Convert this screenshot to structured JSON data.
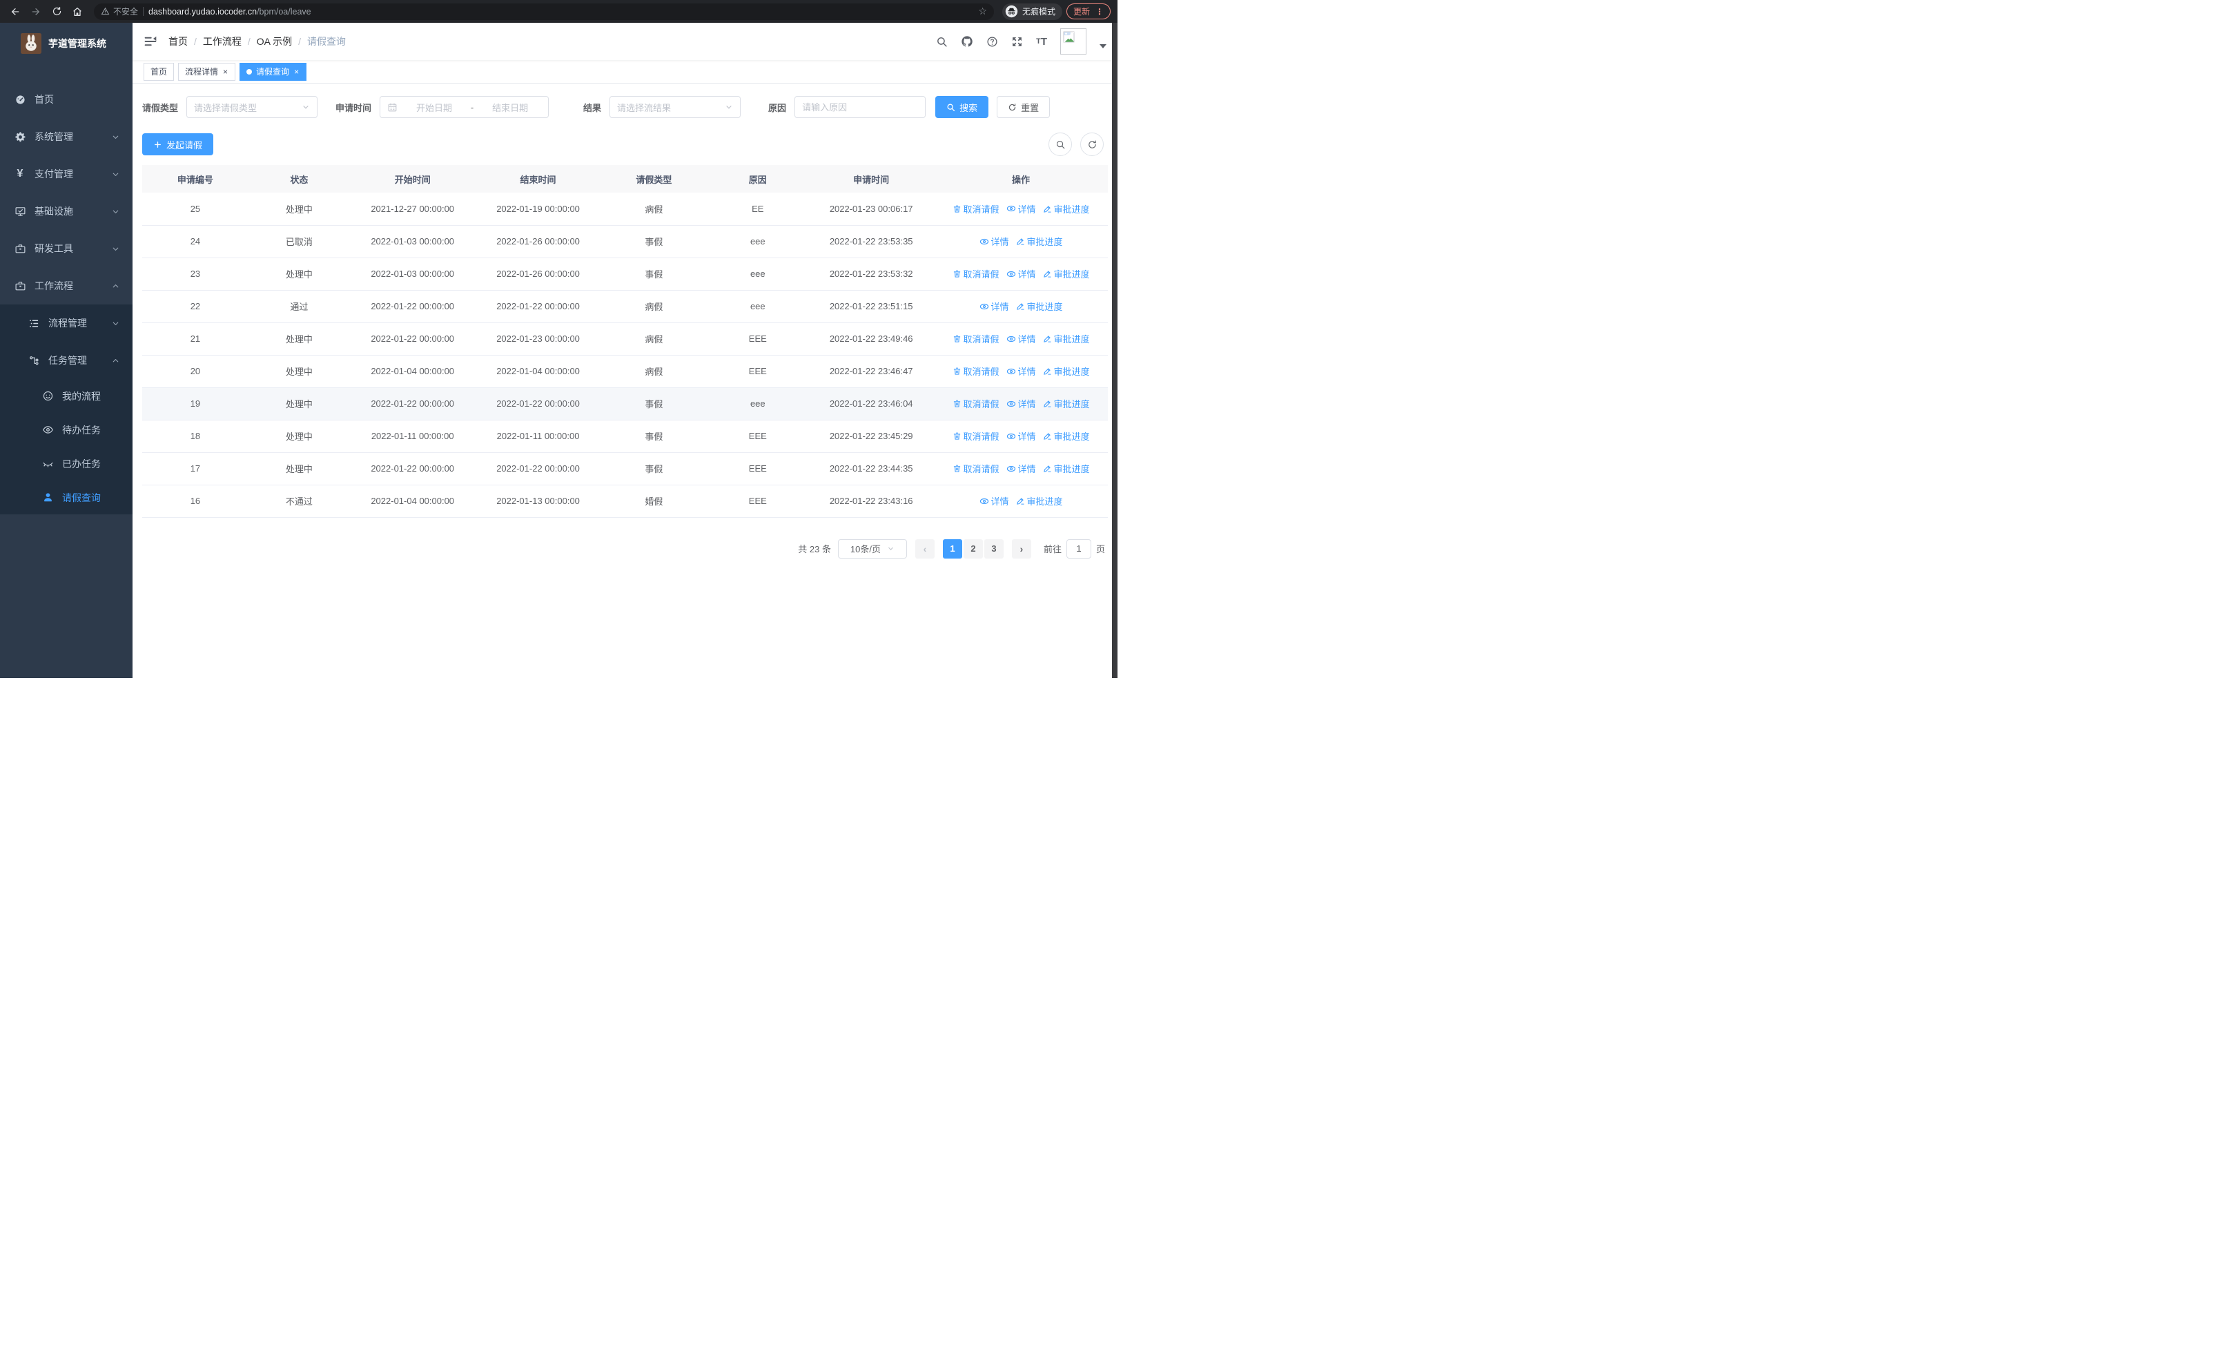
{
  "browser": {
    "security_label": "不安全",
    "url_host": "dashboard.yudao.iocoder.cn",
    "url_path": "/bpm/oa/leave",
    "incognito_label": "无痕模式",
    "update_label": "更新"
  },
  "sidebar": {
    "app_title": "芋道管理系统",
    "menu": [
      {
        "label": "首页",
        "icon": "dashboard-icon",
        "level": 1,
        "expand": null,
        "active": false
      },
      {
        "label": "系统管理",
        "icon": "gear-icon",
        "level": 1,
        "expand": "down",
        "active": false
      },
      {
        "label": "支付管理",
        "icon": "yen-icon",
        "level": 1,
        "expand": "down",
        "active": false
      },
      {
        "label": "基础设施",
        "icon": "monitor-icon",
        "level": 1,
        "expand": "down",
        "active": false
      },
      {
        "label": "研发工具",
        "icon": "toolbox-icon",
        "level": 1,
        "expand": "down",
        "active": false
      },
      {
        "label": "工作流程",
        "icon": "briefcase-icon",
        "level": 1,
        "expand": "up",
        "active": false
      },
      {
        "label": "流程管理",
        "icon": "tree-list-icon",
        "level": 2,
        "expand": "down",
        "active": false
      },
      {
        "label": "任务管理",
        "icon": "org-tree-icon",
        "level": 2,
        "expand": "up",
        "active": false
      },
      {
        "label": "我的流程",
        "icon": "face-icon",
        "level": 3,
        "expand": null,
        "active": false
      },
      {
        "label": "待办任务",
        "icon": "eye-open-icon",
        "level": 3,
        "expand": null,
        "active": false
      },
      {
        "label": "已办任务",
        "icon": "eye-closed-icon",
        "level": 3,
        "expand": null,
        "active": false
      },
      {
        "label": "请假查询",
        "icon": "user-icon",
        "level": 3,
        "expand": null,
        "active": true
      }
    ]
  },
  "header": {
    "breadcrumb": [
      {
        "label": "首页",
        "muted": false
      },
      {
        "label": "工作流程",
        "muted": false
      },
      {
        "label": "OA 示例",
        "muted": false
      },
      {
        "label": "请假查询",
        "muted": true
      }
    ]
  },
  "tags": [
    {
      "label": "首页",
      "closable": false,
      "active": false
    },
    {
      "label": "流程详情",
      "closable": true,
      "active": false
    },
    {
      "label": "请假查询",
      "closable": true,
      "active": true
    }
  ],
  "filters": {
    "leave_type_label": "请假类型",
    "leave_type_placeholder": "请选择请假类型",
    "apply_time_label": "申请时间",
    "start_date_placeholder": "开始日期",
    "range_separator": "-",
    "end_date_placeholder": "结束日期",
    "result_label": "结果",
    "result_placeholder": "请选择流结果",
    "reason_label": "原因",
    "reason_placeholder": "请输入原因",
    "search_label": "搜索",
    "reset_label": "重置"
  },
  "toolbar": {
    "create_label": "发起请假"
  },
  "table": {
    "columns": [
      "申请编号",
      "状态",
      "开始时间",
      "结束时间",
      "请假类型",
      "原因",
      "申请时间",
      "操作"
    ],
    "action_labels": {
      "cancel": "取消请假",
      "detail": "详情",
      "progress": "审批进度"
    },
    "rows": [
      {
        "id": "25",
        "status": "处理中",
        "start": "2021-12-27 00:00:00",
        "end": "2022-01-19 00:00:00",
        "type": "病假",
        "reason": "EE",
        "applied": "2022-01-23 00:06:17",
        "actions": [
          "cancel",
          "detail",
          "progress"
        ],
        "hover": false
      },
      {
        "id": "24",
        "status": "已取消",
        "start": "2022-01-03 00:00:00",
        "end": "2022-01-26 00:00:00",
        "type": "事假",
        "reason": "eee",
        "applied": "2022-01-22 23:53:35",
        "actions": [
          "detail",
          "progress"
        ],
        "hover": false
      },
      {
        "id": "23",
        "status": "处理中",
        "start": "2022-01-03 00:00:00",
        "end": "2022-01-26 00:00:00",
        "type": "事假",
        "reason": "eee",
        "applied": "2022-01-22 23:53:32",
        "actions": [
          "cancel",
          "detail",
          "progress"
        ],
        "hover": false
      },
      {
        "id": "22",
        "status": "通过",
        "start": "2022-01-22 00:00:00",
        "end": "2022-01-22 00:00:00",
        "type": "病假",
        "reason": "eee",
        "applied": "2022-01-22 23:51:15",
        "actions": [
          "detail",
          "progress"
        ],
        "hover": false
      },
      {
        "id": "21",
        "status": "处理中",
        "start": "2022-01-22 00:00:00",
        "end": "2022-01-23 00:00:00",
        "type": "病假",
        "reason": "EEE",
        "applied": "2022-01-22 23:49:46",
        "actions": [
          "cancel",
          "detail",
          "progress"
        ],
        "hover": false
      },
      {
        "id": "20",
        "status": "处理中",
        "start": "2022-01-04 00:00:00",
        "end": "2022-01-04 00:00:00",
        "type": "病假",
        "reason": "EEE",
        "applied": "2022-01-22 23:46:47",
        "actions": [
          "cancel",
          "detail",
          "progress"
        ],
        "hover": false
      },
      {
        "id": "19",
        "status": "处理中",
        "start": "2022-01-22 00:00:00",
        "end": "2022-01-22 00:00:00",
        "type": "事假",
        "reason": "eee",
        "applied": "2022-01-22 23:46:04",
        "actions": [
          "cancel",
          "detail",
          "progress"
        ],
        "hover": true
      },
      {
        "id": "18",
        "status": "处理中",
        "start": "2022-01-11 00:00:00",
        "end": "2022-01-11 00:00:00",
        "type": "事假",
        "reason": "EEE",
        "applied": "2022-01-22 23:45:29",
        "actions": [
          "cancel",
          "detail",
          "progress"
        ],
        "hover": false
      },
      {
        "id": "17",
        "status": "处理中",
        "start": "2022-01-22 00:00:00",
        "end": "2022-01-22 00:00:00",
        "type": "事假",
        "reason": "EEE",
        "applied": "2022-01-22 23:44:35",
        "actions": [
          "cancel",
          "detail",
          "progress"
        ],
        "hover": false
      },
      {
        "id": "16",
        "status": "不通过",
        "start": "2022-01-04 00:00:00",
        "end": "2022-01-13 00:00:00",
        "type": "婚假",
        "reason": "EEE",
        "applied": "2022-01-22 23:43:16",
        "actions": [
          "detail",
          "progress"
        ],
        "hover": false
      }
    ]
  },
  "pagination": {
    "total_label": "共 23 条",
    "page_size_label": "10条/页",
    "pages": [
      "1",
      "2",
      "3"
    ],
    "active_page": "1",
    "goto_label": "前往",
    "goto_value": "1",
    "goto_suffix": "页"
  },
  "colors": {
    "accent": "#409eff",
    "sidebar_bg": "#2d3a4b",
    "submenu_bg": "#1f2d3d",
    "danger": "#f28b82"
  }
}
